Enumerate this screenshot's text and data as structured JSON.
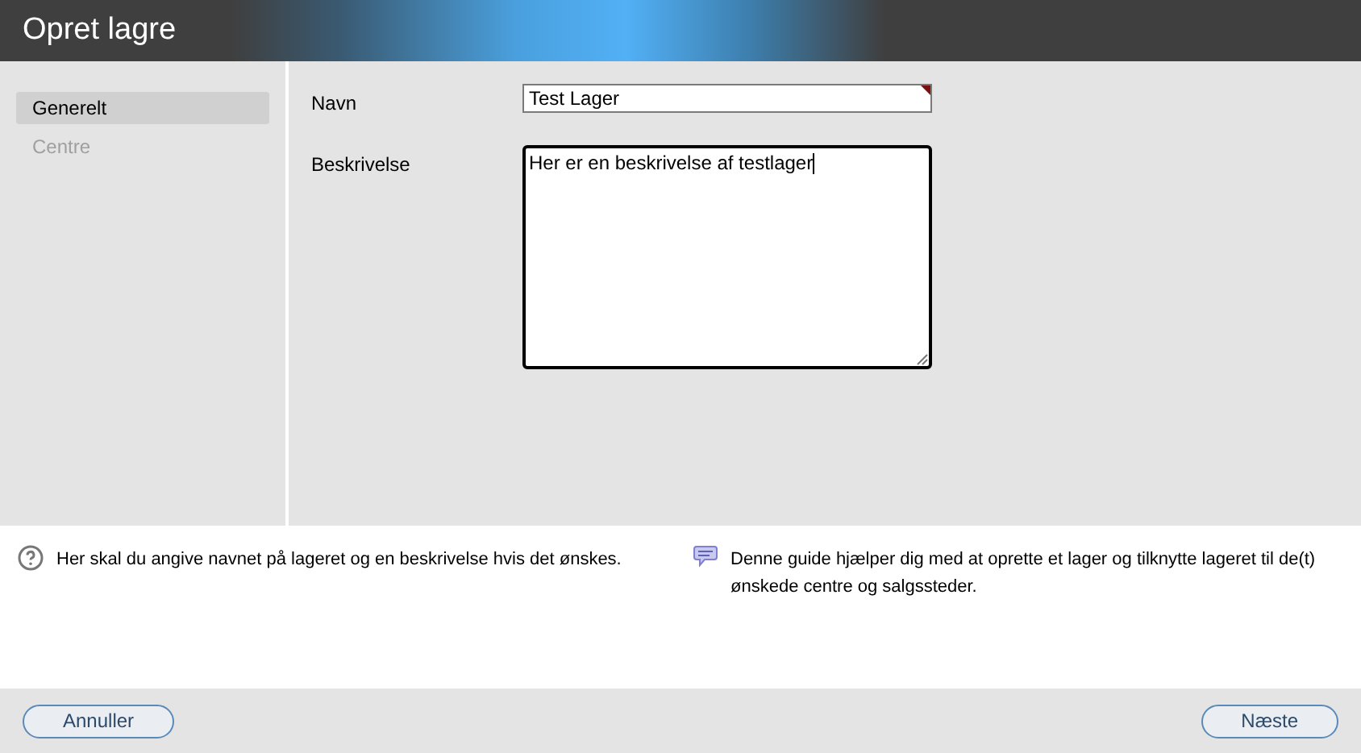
{
  "window": {
    "title": "Opret lagre"
  },
  "sidebar": {
    "items": [
      {
        "label": "Generelt",
        "selected": true,
        "disabled": false
      },
      {
        "label": "Centre",
        "selected": false,
        "disabled": true
      }
    ]
  },
  "form": {
    "fields": [
      {
        "kind": "text",
        "label": "Navn",
        "value": "Test Lager",
        "required": true
      },
      {
        "kind": "textarea",
        "label": "Beskrivelse",
        "value": "Her er en beskrivelse af testlager",
        "required": false
      }
    ]
  },
  "help": {
    "hint": "Her skal du angive navnet på lageret og en beskrivelse hvis det ønskes.",
    "guide": "Denne guide hjælper dig med at oprette et lager og tilknytte lageret til de(t) ønskede centre og salgssteder."
  },
  "buttons": {
    "cancel": "Annuller",
    "next": "Næste"
  }
}
